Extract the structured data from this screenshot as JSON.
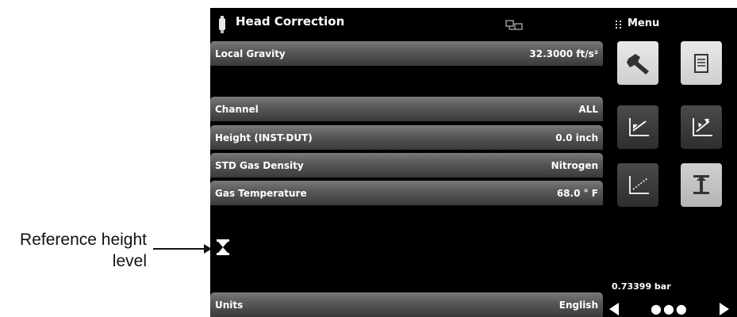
{
  "callout": {
    "line1": "Reference height",
    "line2": "level"
  },
  "header": {
    "title": "Head Correction",
    "title_icon": "transducer-icon",
    "status_icon": "remote-connection-icon"
  },
  "menu": {
    "label": "Menu",
    "tiles": [
      {
        "icon": "wrench-icon"
      },
      {
        "icon": "document-icon"
      },
      {
        "icon": "chart-down-icon"
      },
      {
        "icon": "chart-edit-icon"
      },
      {
        "icon": "chart-line-icon"
      },
      {
        "icon": "head-correction-icon"
      }
    ]
  },
  "settings": {
    "local_gravity_label": "Local Gravity",
    "local_gravity_value": "32.3000 ft/s²",
    "channel_label": "Channel",
    "channel_value": "ALL",
    "height_label": "Height (INST-DUT)",
    "height_value": "0.0 inch",
    "gas_density_label": "STD Gas Density",
    "gas_density_value": "Nitrogen",
    "gas_temp_label": "Gas Temperature",
    "gas_temp_value": "68.0 ° F",
    "units_label": "Units",
    "units_value": "English"
  },
  "footer": {
    "reading": "0.73399  bar",
    "page_dots": "●●●"
  }
}
